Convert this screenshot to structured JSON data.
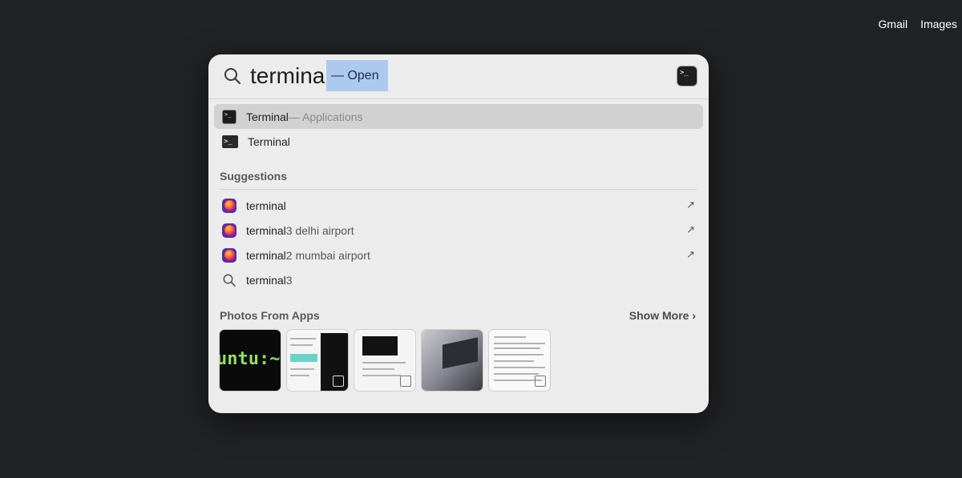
{
  "top_links": [
    "Gmail",
    "Images"
  ],
  "search": {
    "query": "terminal",
    "completion": "— Open"
  },
  "top_hits": [
    {
      "label": "Terminal",
      "suffix": " — Applications"
    },
    {
      "label": "Terminal",
      "suffix": ""
    }
  ],
  "suggestions": {
    "title": "Suggestions",
    "items": [
      {
        "bold": "terminal",
        "rest": ""
      },
      {
        "bold": "terminal",
        "rest": " 3 delhi airport"
      },
      {
        "bold": "terminal",
        "rest": " 2 mumbai airport"
      },
      {
        "bold": "terminal",
        "rest": " 3"
      }
    ]
  },
  "photos": {
    "title": "Photos From Apps",
    "show_more": "Show More ›",
    "thumb1_text": "untu:~$ su"
  },
  "icons": {
    "search": "magnifier-icon",
    "terminal": "terminal-app-icon",
    "firefox": "firefox-icon",
    "arrow": "open-arrow-icon"
  }
}
